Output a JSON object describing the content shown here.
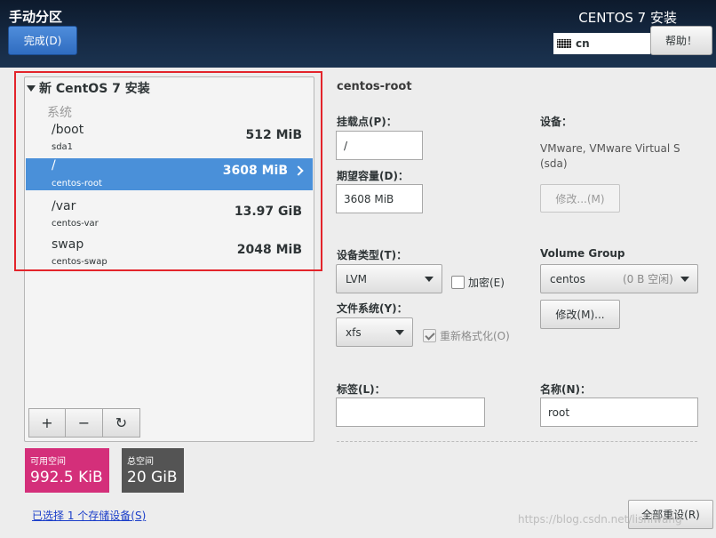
{
  "header": {
    "title": "手动分区",
    "done_label": "完成(D)",
    "product": "CENTOS 7 安装",
    "keyboard_layout": "cn",
    "help_label": "帮助！"
  },
  "partitions": {
    "install_title": "新 CentOS 7 安装",
    "system_label": "系统",
    "items": [
      {
        "mount": "/boot",
        "device": "sda1",
        "size": "512 MiB"
      },
      {
        "mount": "/",
        "device": "centos-root",
        "size": "3608 MiB"
      },
      {
        "mount": "/var",
        "device": "centos-var",
        "size": "13.97 GiB"
      },
      {
        "mount": "swap",
        "device": "centos-swap",
        "size": "2048 MiB"
      }
    ],
    "add_label": "+",
    "remove_label": "−",
    "refresh_label": "↻"
  },
  "space": {
    "available_label": "可用空间",
    "available_value": "992.5 KiB",
    "total_label": "总空间",
    "total_value": "20 GiB",
    "selected_devices": "已选择 1 个存储设备(S)"
  },
  "detail": {
    "title": "centos-root",
    "mount_label": "挂载点(P)：",
    "mount_value": "/",
    "capacity_label": "期望容量(D)：",
    "capacity_value": "3608 MiB",
    "device_label": "设备：",
    "device_value": "VMware, VMware Virtual S",
    "device_value2": "(sda)",
    "modify_device": "修改...(M)",
    "device_type_label": "设备类型(T)：",
    "device_type_value": "LVM",
    "encrypt_label": "加密(E)",
    "vg_label": "Volume Group",
    "vg_value": "centos",
    "vg_free": "(0 B 空闲)",
    "fs_label": "文件系统(Y)：",
    "fs_value": "xfs",
    "reformat_label": "重新格式化(O)",
    "modify_vg": "修改(M)...",
    "tag_label": "标签(L)：",
    "tag_value": "",
    "name_label": "名称(N)：",
    "name_value": "root"
  },
  "footer": {
    "reset_label": "全部重设(R)",
    "watermark": "https://blog.csdn.net/lishiwang"
  },
  "colors": {
    "selected_row": "#4a90d9",
    "available_bg": "#d42f7a",
    "total_bg": "#545454",
    "highlight_box": "#e3242b"
  }
}
